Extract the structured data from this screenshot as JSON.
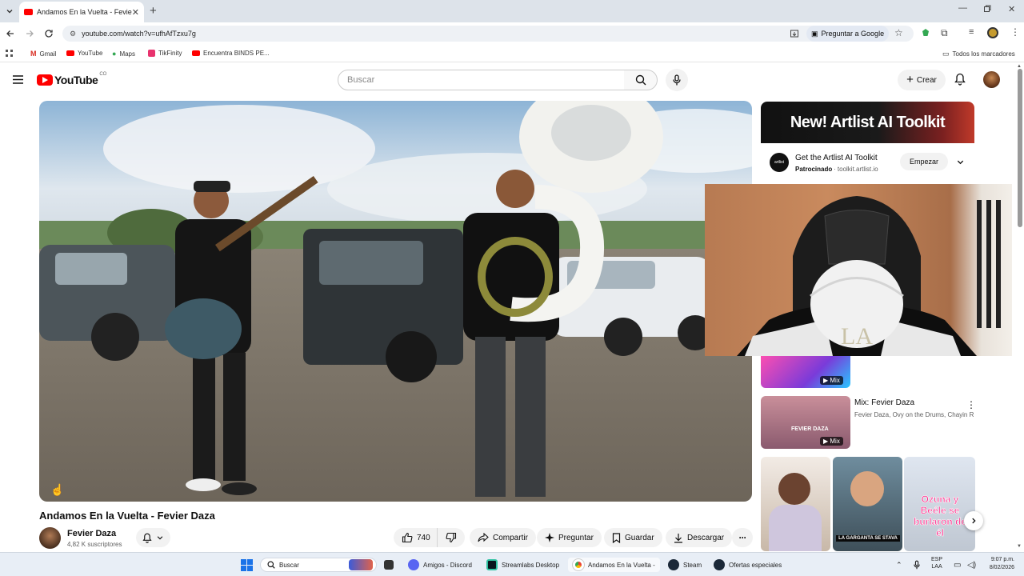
{
  "browser": {
    "tab_title": "Andamos En la Vuelta - Fevier",
    "url": "youtube.com/watch?v=ufhAfTzxu7g",
    "ask_google": "Preguntar a Google",
    "bookmarks": [
      "Gmail",
      "YouTube",
      "Maps",
      "TikFinity",
      "Encuentra BINDS PE..."
    ],
    "all_bookmarks": "Todos los marcadores"
  },
  "youtube": {
    "logo_text": "YouTube",
    "country": "CO",
    "search_placeholder": "Buscar",
    "create_label": "Crear"
  },
  "video": {
    "title": "Andamos En la Vuelta - Fevier Daza",
    "channel": "Fevier Daza",
    "subscribers": "4,82 K suscriptores",
    "likes": "740",
    "actions": {
      "share": "Compartir",
      "ask": "Preguntar",
      "save": "Guardar",
      "download": "Descargar"
    }
  },
  "ad": {
    "banner": "New! Artlist AI Toolkit",
    "title": "Get the Artlist AI Toolkit",
    "sponsored": "Patrocinado",
    "domain": "toolkit.artlist.io",
    "cta": "Empezar",
    "logo_text": "artlist"
  },
  "sidebar": {
    "mix_badge": "Mix",
    "mix_title": "Mix: Fevier Daza",
    "mix_sub": "Fevier Daza, Ovy on the Drums, Chayin R...",
    "thumb_mix_text": "FEVIER DAZA",
    "short1_caption": "LA GARGANTA SE STAVA",
    "short2_caption": "Ozuna y Beéle se burlaron de él"
  },
  "taskbar": {
    "search": "Buscar",
    "apps": [
      "Amigos - Discord",
      "Streamlabs Desktop",
      "Andamos En la Vuelta -",
      "Steam",
      "Ofertas especiales"
    ],
    "lang1": "ESP",
    "lang2": "LAA",
    "time": "9:07 p.m.",
    "date": "8/02/2026"
  }
}
